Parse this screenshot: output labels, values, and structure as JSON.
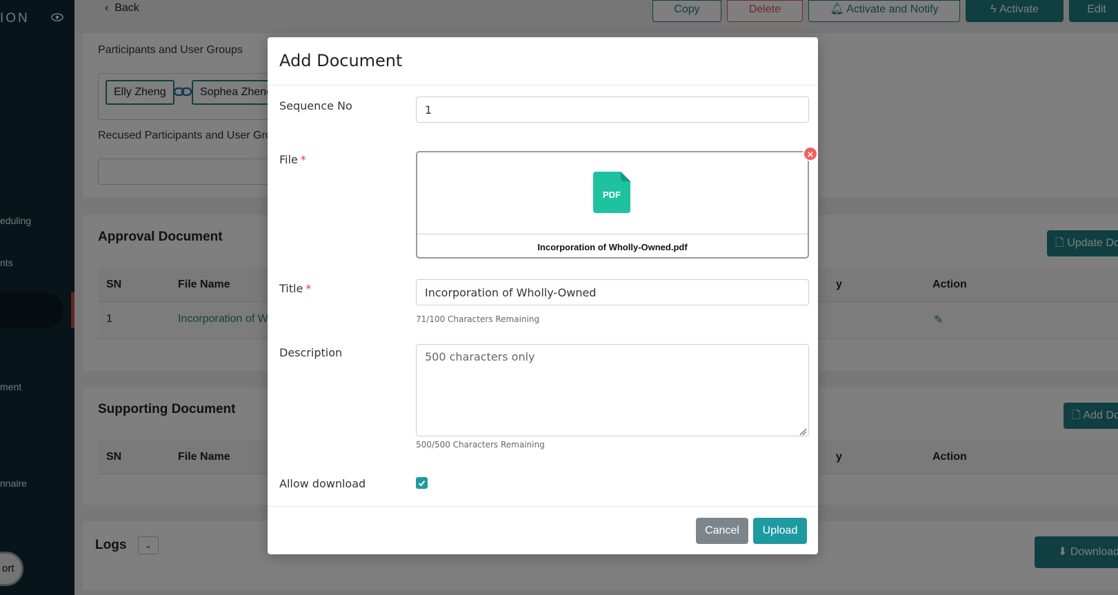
{
  "sidebar": {
    "brand": "ION",
    "items": [
      {
        "label": "eduling"
      },
      {
        "label": "nts"
      },
      {
        "label": "ment"
      },
      {
        "label": "nnaire"
      }
    ],
    "bottom_pill": "ort"
  },
  "page": {
    "back_label": "Back",
    "toolbar": {
      "copy": "Copy",
      "delete": "Delete",
      "activate_notify": "Activate and Notify",
      "activate": "Activate",
      "edit": "Edit"
    },
    "participants_label": "Participants and User Groups",
    "participants": [
      "Elly Zheng",
      "Sophea Zheng"
    ],
    "recused_label": "Recused Participants and User Gro",
    "approval": {
      "title": "Approval Document",
      "update_button": "Update Do",
      "headers": {
        "sn": "SN",
        "file_name": "File Name",
        "col3": "y",
        "action": "Action"
      },
      "rows": [
        {
          "sn": "1",
          "file_name": "Incorporation of W"
        }
      ]
    },
    "supporting": {
      "title": "Supporting Document",
      "add_button": "Add Do",
      "headers": {
        "sn": "SN",
        "file_name": "File Name",
        "col3": "y",
        "action": "Action"
      }
    },
    "logs": {
      "title": "Logs",
      "download_button": "Download"
    }
  },
  "modal": {
    "title": "Add Document",
    "sequence": {
      "label": "Sequence No",
      "value": "1"
    },
    "file": {
      "label": "File",
      "file_name": "Incorporation of Wholly-Owned.pdf",
      "icon_text": "PDF"
    },
    "title_field": {
      "label": "Title",
      "value": "Incorporation of Wholly-Owned",
      "help": "71/100 Characters Remaining"
    },
    "description": {
      "label": "Description",
      "placeholder": "500 characters only",
      "help": "500/500 Characters Remaining"
    },
    "allow_download": {
      "label": "Allow download",
      "checked": true
    },
    "cancel": "Cancel",
    "upload": "Upload"
  },
  "colors": {
    "accent": "#1e7f80",
    "modal_button": "#1e9aa0",
    "danger": "#e05252",
    "sidebar": "#0f2a36"
  }
}
